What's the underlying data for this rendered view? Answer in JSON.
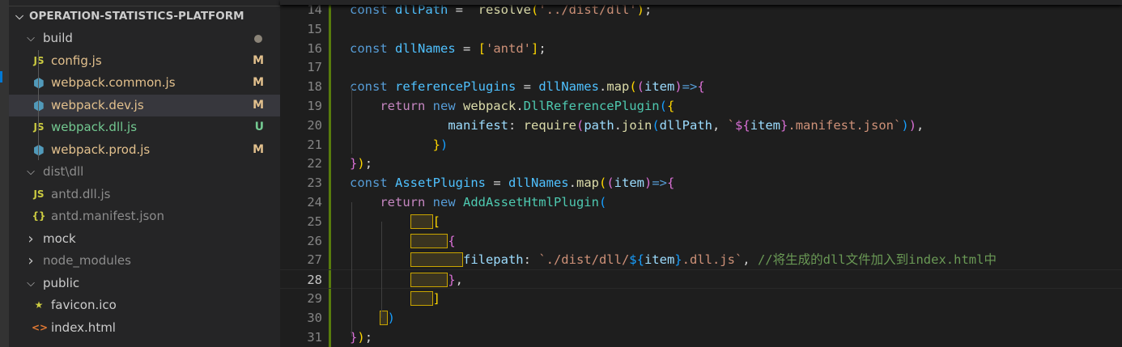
{
  "explorer": {
    "root": "OPERATION-STATISTICS-PLATFORM",
    "items": [
      {
        "label": "build",
        "type": "folder",
        "open": true,
        "depth": 1,
        "color": "#cccccc",
        "dot": true
      },
      {
        "label": "config.js",
        "type": "js",
        "depth": 2,
        "color": "#e2c08d",
        "badge": "M",
        "badge_color": "#e2c08d"
      },
      {
        "label": "webpack.common.js",
        "type": "webpack",
        "depth": 2,
        "color": "#e2c08d",
        "badge": "M",
        "badge_color": "#e2c08d"
      },
      {
        "label": "webpack.dev.js",
        "type": "webpack",
        "depth": 2,
        "color": "#e2c08d",
        "badge": "M",
        "badge_color": "#e2c08d",
        "selected": true
      },
      {
        "label": "webpack.dll.js",
        "type": "js",
        "depth": 2,
        "color": "#73c991",
        "badge": "U",
        "badge_color": "#73c991"
      },
      {
        "label": "webpack.prod.js",
        "type": "webpack",
        "depth": 2,
        "color": "#e2c08d",
        "badge": "M",
        "badge_color": "#e2c08d"
      },
      {
        "label": "dist\\dll",
        "type": "folder",
        "open": true,
        "depth": 1,
        "color": "#8c8c8c"
      },
      {
        "label": "antd.dll.js",
        "type": "js",
        "depth": 2,
        "color": "#8c8c8c"
      },
      {
        "label": "antd.manifest.json",
        "type": "json",
        "depth": 2,
        "color": "#8c8c8c"
      },
      {
        "label": "mock",
        "type": "folder",
        "open": false,
        "depth": 1,
        "color": "#cccccc"
      },
      {
        "label": "node_modules",
        "type": "folder",
        "open": false,
        "depth": 1,
        "color": "#8c8c8c"
      },
      {
        "label": "public",
        "type": "folder",
        "open": true,
        "depth": 1,
        "color": "#cccccc"
      },
      {
        "label": "favicon.ico",
        "type": "favicon",
        "depth": 2,
        "color": "#cccccc"
      },
      {
        "label": "index.html",
        "type": "html",
        "depth": 2,
        "color": "#cccccc"
      }
    ]
  },
  "editor": {
    "current_line": 28,
    "lines": [
      {
        "n": "14",
        "t": [
          [
            "const ",
            "kw"
          ],
          [
            "dllPath",
            "var"
          ],
          [
            " =  ",
            "p"
          ],
          [
            "resolve",
            "fn"
          ],
          [
            "(",
            "b1"
          ],
          [
            "'../dist/dll'",
            "str"
          ],
          [
            ")",
            "b1"
          ],
          [
            ";",
            "p"
          ]
        ]
      },
      {
        "n": "15",
        "t": []
      },
      {
        "n": "16",
        "t": [
          [
            "const ",
            "kw"
          ],
          [
            "dllNames",
            "var"
          ],
          [
            " = ",
            "p"
          ],
          [
            "[",
            "b1"
          ],
          [
            "'antd'",
            "str"
          ],
          [
            "]",
            "b1"
          ],
          [
            ";",
            "p"
          ]
        ]
      },
      {
        "n": "17",
        "t": []
      },
      {
        "n": "18",
        "t": [
          [
            "const ",
            "kw"
          ],
          [
            "referencePlugins",
            "var"
          ],
          [
            " = ",
            "p"
          ],
          [
            "dllNames",
            "var"
          ],
          [
            ".",
            "p"
          ],
          [
            "map",
            "fn"
          ],
          [
            "(",
            "b1"
          ],
          [
            "(",
            "b2"
          ],
          [
            "item",
            "prop"
          ],
          [
            ")",
            "b2"
          ],
          [
            "=>",
            "kw"
          ],
          [
            "{",
            "b2"
          ]
        ]
      },
      {
        "n": "19",
        "t": [
          [
            "    ",
            "p"
          ],
          [
            "return ",
            "ctl"
          ],
          [
            "new ",
            "kw"
          ],
          [
            "webpack",
            "fn"
          ],
          [
            ".",
            "p"
          ],
          [
            "DllReferencePlugin",
            "cls"
          ],
          [
            "(",
            "b3"
          ],
          [
            "{",
            "b1"
          ]
        ]
      },
      {
        "n": "20",
        "t": [
          [
            "             ",
            "p"
          ],
          [
            "manifest",
            "prop"
          ],
          [
            ": ",
            "p"
          ],
          [
            "require",
            "fn"
          ],
          [
            "(",
            "b2"
          ],
          [
            "path",
            "prop"
          ],
          [
            ".",
            "p"
          ],
          [
            "join",
            "fn"
          ],
          [
            "(",
            "b3"
          ],
          [
            "dllPath",
            "prop"
          ],
          [
            ", ",
            "p"
          ],
          [
            "`",
            "str"
          ],
          [
            "${",
            "b2"
          ],
          [
            "item",
            "prop"
          ],
          [
            "}",
            "b2"
          ],
          [
            ".manifest.json`",
            "str"
          ],
          [
            ")",
            "b3"
          ],
          [
            ")",
            "b2"
          ],
          [
            ",",
            "p"
          ]
        ]
      },
      {
        "n": "21",
        "t": [
          [
            "           ",
            "p"
          ],
          [
            "}",
            "b1"
          ],
          [
            ")",
            "b3"
          ]
        ]
      },
      {
        "n": "22",
        "t": [
          [
            "}",
            "b2"
          ],
          [
            ")",
            "b1"
          ],
          [
            ";",
            "p"
          ]
        ]
      },
      {
        "n": "23",
        "t": [
          [
            "const ",
            "kw"
          ],
          [
            "AssetPlugins",
            "var"
          ],
          [
            " = ",
            "p"
          ],
          [
            "dllNames",
            "var"
          ],
          [
            ".",
            "p"
          ],
          [
            "map",
            "fn"
          ],
          [
            "(",
            "b1"
          ],
          [
            "(",
            "b2"
          ],
          [
            "item",
            "prop"
          ],
          [
            ")",
            "b2"
          ],
          [
            "=>",
            "kw"
          ],
          [
            "{",
            "b2"
          ]
        ]
      },
      {
        "n": "24",
        "t": [
          [
            "    ",
            "p"
          ],
          [
            "return ",
            "ctl"
          ],
          [
            "new ",
            "kw"
          ],
          [
            "AddAssetHtmlPlugin",
            "cls"
          ],
          [
            "(",
            "b3"
          ]
        ]
      },
      {
        "n": "25",
        "t": [
          [
            "        ",
            "p"
          ],
          [
            "   ",
            "ws"
          ],
          [
            "[",
            "b1"
          ]
        ]
      },
      {
        "n": "26",
        "t": [
          [
            "        ",
            "p"
          ],
          [
            "     ",
            "ws"
          ],
          [
            "{",
            "b2"
          ]
        ]
      },
      {
        "n": "27",
        "t": [
          [
            "        ",
            "p"
          ],
          [
            "       ",
            "ws"
          ],
          [
            "filepath",
            "prop"
          ],
          [
            ": ",
            "p"
          ],
          [
            "`./dist/dll/",
            "str"
          ],
          [
            "${",
            "b3"
          ],
          [
            "item",
            "prop"
          ],
          [
            "}",
            "b3"
          ],
          [
            ".dll.js`",
            "str"
          ],
          [
            ", ",
            "p"
          ],
          [
            "//将生成的dll文件加入到index.html中",
            "cm"
          ]
        ]
      },
      {
        "n": "28",
        "t": [
          [
            "        ",
            "p"
          ],
          [
            "     ",
            "ws"
          ],
          [
            "}",
            "b2"
          ],
          [
            ",",
            "p"
          ]
        ]
      },
      {
        "n": "29",
        "t": [
          [
            "        ",
            "p"
          ],
          [
            "   ",
            "ws"
          ],
          [
            "]",
            "b1"
          ]
        ]
      },
      {
        "n": "30",
        "t": [
          [
            "    ",
            "p"
          ],
          [
            " ",
            "ws"
          ],
          [
            ")",
            "b3"
          ]
        ]
      },
      {
        "n": "31",
        "t": [
          [
            "}",
            "b2"
          ],
          [
            ")",
            "b1"
          ],
          [
            ";",
            "p"
          ]
        ]
      }
    ]
  }
}
